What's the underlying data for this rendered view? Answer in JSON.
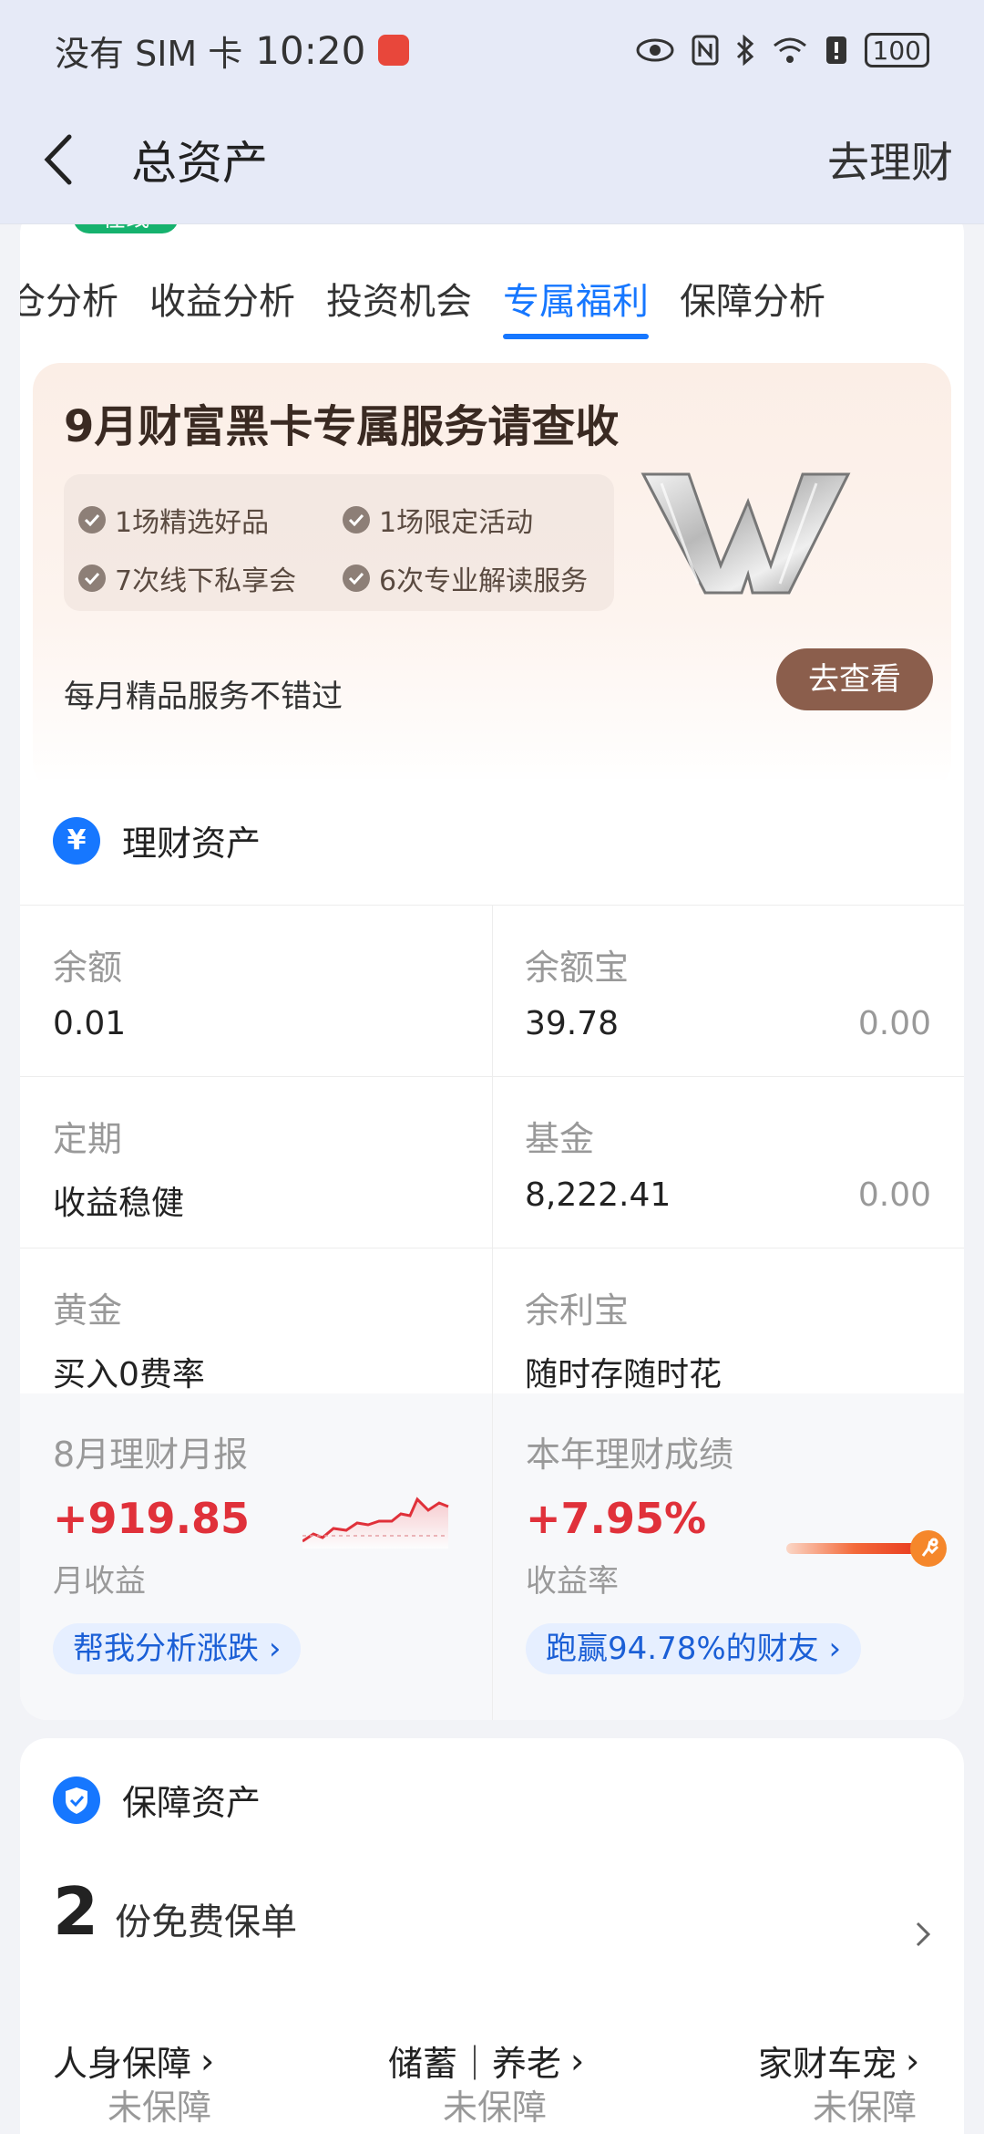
{
  "status_bar": {
    "carrier": "没有 SIM 卡",
    "time": "10:20",
    "battery": "100"
  },
  "header": {
    "title": "总资产",
    "right_link": "去理财"
  },
  "peek": {
    "online_tag": "在线"
  },
  "tabs": [
    {
      "label": "仓分析"
    },
    {
      "label": "收益分析"
    },
    {
      "label": "投资机会"
    },
    {
      "label": "专属福利",
      "active": true
    },
    {
      "label": "保障分析"
    }
  ],
  "promo": {
    "title": "9月财富黑卡专属服务请查收",
    "items": [
      "1场精选好品",
      "1场限定活动",
      "7次线下私享会",
      "6次专业解读服务"
    ],
    "subtitle": "每月精品服务不错过",
    "button": "去查看"
  },
  "finance": {
    "title": "理财资产",
    "icon_char": "¥",
    "cells": [
      {
        "label": "余额",
        "value": "0.01",
        "value2": ""
      },
      {
        "label": "余额宝",
        "value": "39.78",
        "value2": "0.00"
      },
      {
        "label": "定期",
        "value": "收益稳健",
        "value2": ""
      },
      {
        "label": "基金",
        "value": "8,222.41",
        "value2": "0.00"
      },
      {
        "label": "黄金",
        "value": "买入0费率",
        "value2": ""
      },
      {
        "label": "余利宝",
        "value": "随时存随时花",
        "value2": ""
      }
    ],
    "monthly": {
      "label": "8月理财月报",
      "value": "+919.85",
      "sub": "月收益",
      "pill": "帮我分析涨跌"
    },
    "yearly": {
      "label": "本年理财成绩",
      "value": "+7.95%",
      "sub": "收益率",
      "pill": "跑赢94.78%的财友"
    }
  },
  "protection": {
    "title": "保障资产",
    "policy_count": "2",
    "policy_text": "份免费保单",
    "categories": [
      {
        "label": "人身保障",
        "status": "未保障"
      },
      {
        "label": "储蓄｜养老",
        "status": "未保障"
      },
      {
        "label": "家财车宠",
        "status": "未保障"
      }
    ]
  },
  "colors": {
    "accent": "#1677ff",
    "gain": "#e0313a",
    "brown_button": "#8b5e4c"
  }
}
